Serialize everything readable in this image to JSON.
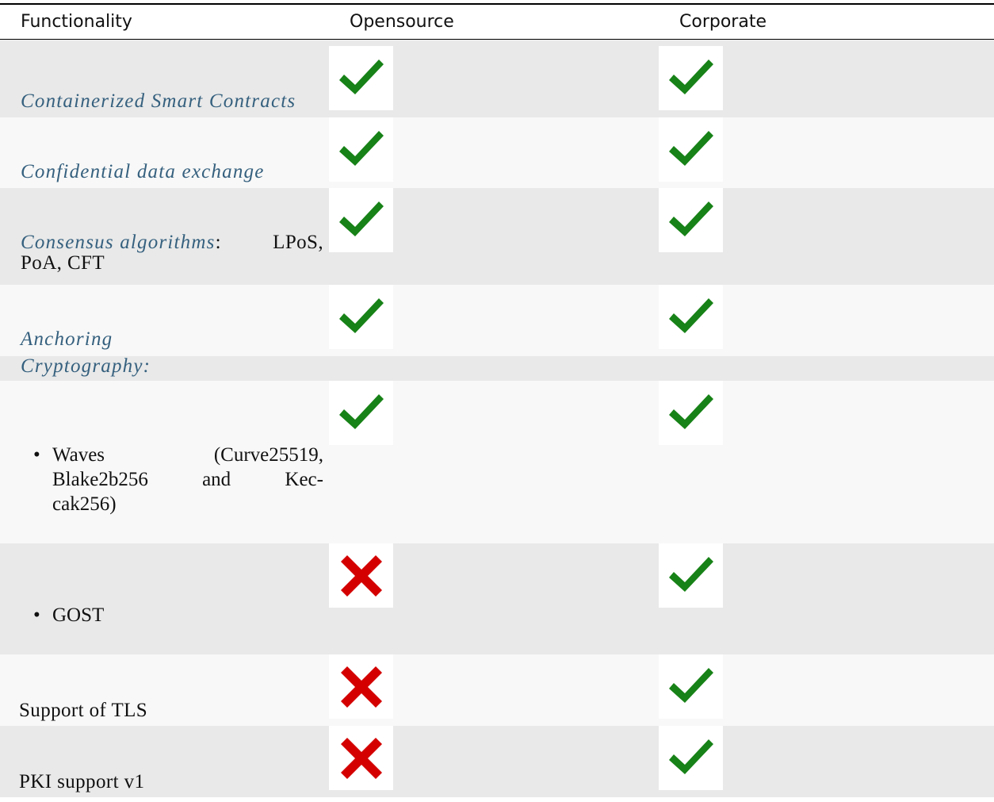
{
  "header": {
    "col1": "Functionality",
    "col2": "Opensource",
    "col3": "Corporate"
  },
  "rows": [
    {
      "label": "Containerized Smart Contracts",
      "opensource": "check",
      "corporate": "check"
    },
    {
      "label": "Confidential data exchange",
      "opensource": "check",
      "corporate": "check"
    },
    {
      "label_link": "Consensus algorithms",
      "label_rest_1": ":",
      "label_rest_2": "LPoS,",
      "label_line2": "PoA, CFT",
      "opensource": "check",
      "corporate": "check"
    },
    {
      "label": "Anchoring",
      "opensource": "check",
      "corporate": "check"
    },
    {
      "label": "Cryptography:"
    },
    {
      "bullet": "•",
      "line1_a": "Waves",
      "line1_b": "(Curve25519,",
      "line2_a": "Blake2b256",
      "line2_b": "and",
      "line2_c": "Kec-",
      "line3": "cak256)",
      "opensource": "check",
      "corporate": "check"
    },
    {
      "bullet": "•",
      "label": "GOST",
      "opensource": "cross",
      "corporate": "check"
    },
    {
      "label": "Support of TLS",
      "opensource": "cross",
      "corporate": "check"
    },
    {
      "label": "PKI support v1",
      "opensource": "cross",
      "corporate": "check"
    }
  ],
  "icons": {
    "check": "checkmark-icon",
    "cross": "cross-icon",
    "check_color": "#178217",
    "cross_color": "#d40000"
  }
}
